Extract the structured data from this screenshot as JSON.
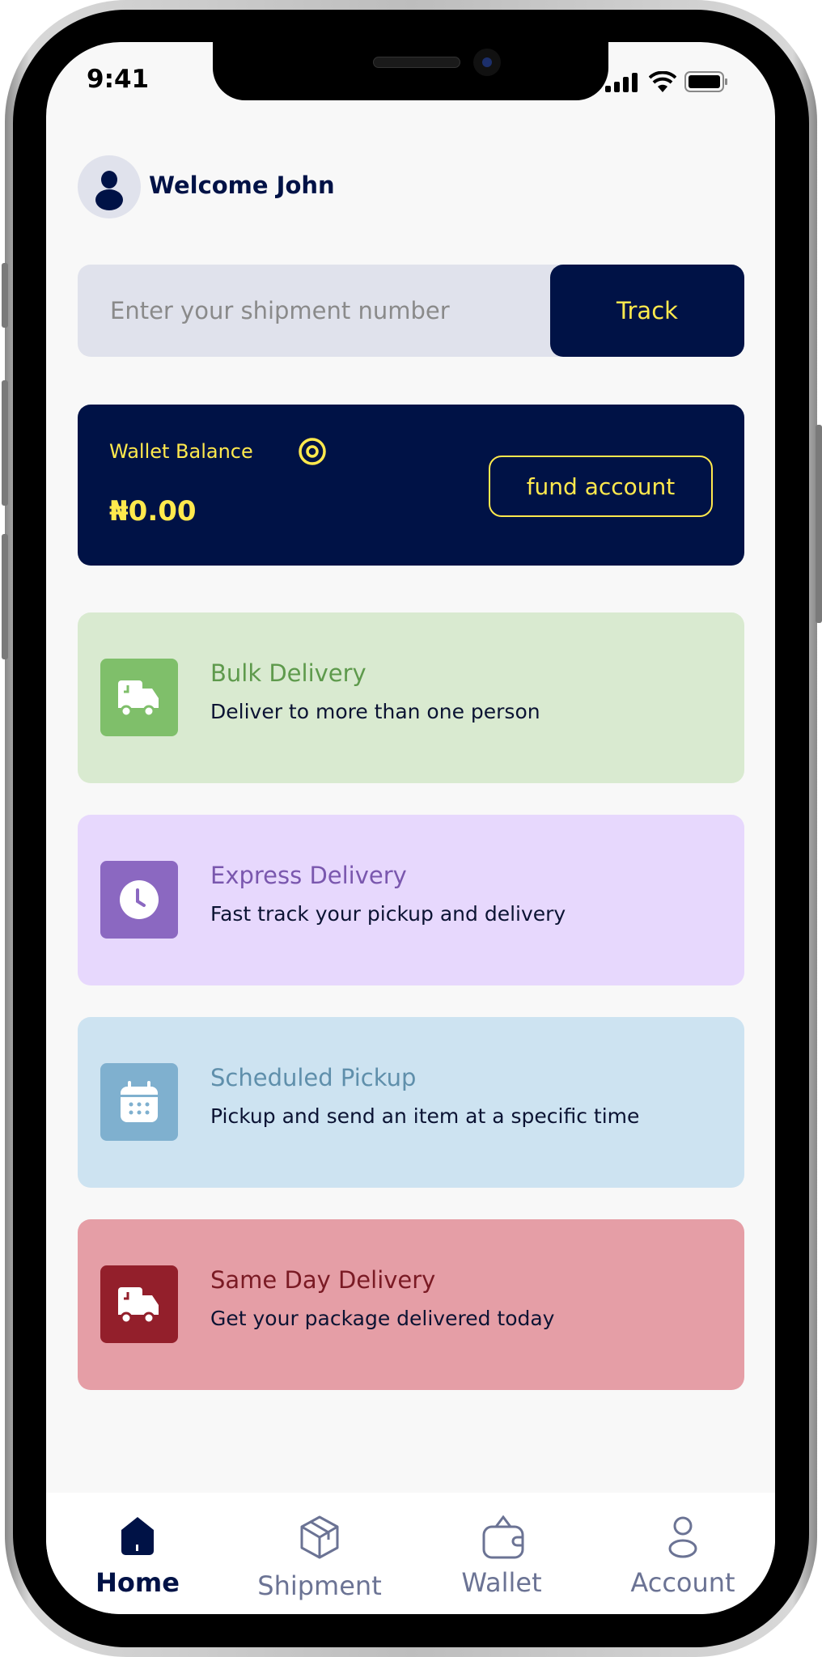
{
  "status_bar": {
    "time": "9:41"
  },
  "header": {
    "greeting": "Welcome John"
  },
  "search": {
    "placeholder": "Enter your shipment number",
    "value": "",
    "button_label": "Track"
  },
  "wallet": {
    "label": "Wallet Balance",
    "balance": "₦0.00",
    "fund_button": "fund account"
  },
  "services": [
    {
      "title": "Bulk Delivery",
      "subtitle": "Deliver to more than one person",
      "icon": "truck-icon",
      "bg": "#d9ead0",
      "icon_bg": "#7fbf6a",
      "title_color": "#5e9a4c"
    },
    {
      "title": "Express Delivery",
      "subtitle": "Fast track your pickup and delivery",
      "icon": "clock-icon",
      "bg": "#e7d8fd",
      "icon_bg": "#8b68c1",
      "title_color": "#7a57ae"
    },
    {
      "title": "Scheduled Pickup",
      "subtitle": "Pickup and send an item at a specific time",
      "icon": "calendar-icon",
      "bg": "#cde3f1",
      "icon_bg": "#7fb0cf",
      "title_color": "#5f8fab"
    },
    {
      "title": "Same Day Delivery",
      "subtitle": "Get your package delivered today",
      "icon": "truck-icon",
      "bg": "#e59ea6",
      "icon_bg": "#931f2b",
      "title_color": "#7a1a24"
    }
  ],
  "nav": {
    "items": [
      {
        "label": "Home",
        "icon": "home-icon",
        "active": true
      },
      {
        "label": "Shipment",
        "icon": "box-icon",
        "active": false
      },
      {
        "label": "Wallet",
        "icon": "wallet-icon",
        "active": false
      },
      {
        "label": "Account",
        "icon": "user-icon",
        "active": false
      }
    ]
  },
  "colors": {
    "primary": "#001246",
    "accent": "#ffe94d",
    "background": "#f8f8f8",
    "nav_inactive": "#6b7394"
  }
}
